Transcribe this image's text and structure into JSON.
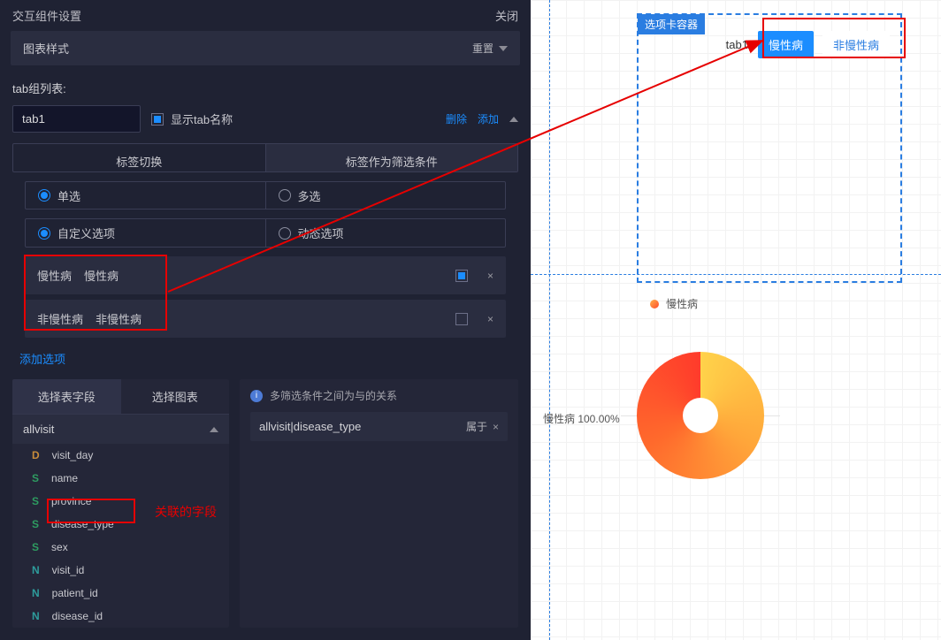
{
  "panel": {
    "title": "交互组件设置",
    "close": "关闭",
    "chart_style": "图表样式",
    "reset": "重置",
    "tab_group_list": "tab组列表:",
    "tab1_value": "tab1",
    "show_tab_name": "显示tab名称",
    "delete": "删除",
    "add": "添加",
    "subtabs": {
      "switch": "标签切换",
      "filter": "标签作为筛选条件"
    },
    "radio_mode": {
      "single": "单选",
      "multi": "多选"
    },
    "radio_src": {
      "custom": "自定义选项",
      "dynamic": "动态选项"
    },
    "options": [
      {
        "key": "慢性病",
        "val": "慢性病",
        "checked": true
      },
      {
        "key": "非慢性病",
        "val": "非慢性病",
        "checked": false
      }
    ],
    "add_option": "添加选项",
    "field_tabs": {
      "field": "选择表字段",
      "chart": "选择图表"
    },
    "table_name": "allvisit",
    "fields": [
      {
        "t": "D",
        "name": "visit_day"
      },
      {
        "t": "S",
        "name": "name"
      },
      {
        "t": "S",
        "name": "province"
      },
      {
        "t": "S",
        "name": "disease_type"
      },
      {
        "t": "S",
        "name": "sex"
      },
      {
        "t": "N",
        "name": "visit_id"
      },
      {
        "t": "N",
        "name": "patient_id"
      },
      {
        "t": "N",
        "name": "disease_id"
      }
    ],
    "filter_hint": "多筛选条件之间为与的关系",
    "filter_chip": {
      "expr": "allvisit|disease_type",
      "rel": "属于"
    }
  },
  "canvas": {
    "card_tag": "选项卡容器",
    "tab_label": "tab1",
    "tabs": [
      {
        "label": "慢性病",
        "active": true
      },
      {
        "label": "非慢性病",
        "active": false
      }
    ],
    "legend_label": "慢性病",
    "donut_label": "慢性病 100.00%"
  },
  "annotations": {
    "assoc_field": "关联的字段"
  },
  "chart_data": {
    "type": "pie",
    "title": "",
    "series": [
      {
        "name": "慢性病",
        "value": 100.0
      }
    ],
    "unit": "%",
    "legend_position": "top"
  }
}
